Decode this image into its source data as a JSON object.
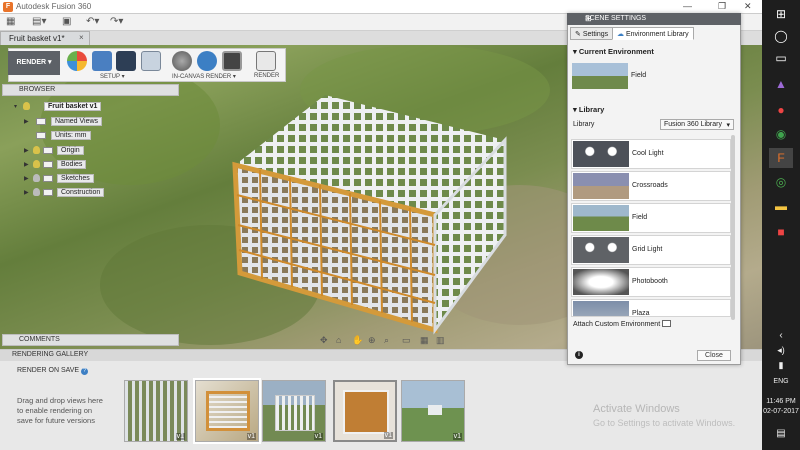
{
  "window": {
    "title": "Autodesk Fusion 360",
    "app_icon": "F"
  },
  "document_tab": {
    "label": "Fruit basket v1*",
    "close": "×"
  },
  "ribbon": {
    "workspace": "RENDER ▾",
    "setup_label": "SETUP ▾",
    "in_canvas_label": "IN-CANVAS RENDER ▾",
    "render_label": "RENDER"
  },
  "browser": {
    "header": "BROWSER",
    "items": [
      {
        "label": "Fruit basket v1"
      },
      {
        "label": "Named Views"
      },
      {
        "label": "Units: mm"
      },
      {
        "label": "Origin"
      },
      {
        "label": "Bodies"
      },
      {
        "label": "Sketches"
      },
      {
        "label": "Construction"
      }
    ]
  },
  "comments": {
    "header": "COMMENTS"
  },
  "rendering_gallery": {
    "header": "RENDERING GALLERY",
    "render_on_save": "RENDER ON SAVE",
    "drag_drop_text": "Drag and drop views here to enable rendering on save for future versions",
    "thumbnails": [
      {
        "version": "v1",
        "color": "#9aa07a"
      },
      {
        "version": "v1",
        "color": "#c9c2ad"
      },
      {
        "version": "v1",
        "color": "#8f9b73"
      },
      {
        "version": "v1",
        "color": "#b98a48"
      },
      {
        "version": "v1",
        "color": "#6f8f55"
      }
    ]
  },
  "watermark": {
    "line1": "Activate Windows",
    "line2": "Go to Settings to activate Windows."
  },
  "scene_settings": {
    "title": "SCENE SETTINGS",
    "tabs": [
      {
        "label": "Settings"
      },
      {
        "label": "Environment Library"
      }
    ],
    "current_env_header": "Current Environment",
    "current_env": "Field",
    "library_header": "Library",
    "library_label": "Library",
    "library_selected": "Fusion 360 Library",
    "environments": [
      {
        "name": "Cool Light",
        "color": "#555a63"
      },
      {
        "name": "Crossroads",
        "color": "#8a8fa8"
      },
      {
        "name": "Field",
        "color": "#7c9aa8"
      },
      {
        "name": "Grid Light",
        "color": "#6a6d70"
      },
      {
        "name": "Photobooth",
        "color": "#cfcfcf"
      },
      {
        "name": "Plaza",
        "color": "#7d8ea8"
      }
    ],
    "attach_label": "Attach Custom Environment",
    "close_label": "Close"
  },
  "taskbar": {
    "lang": "ENG",
    "time": "11:46 PM",
    "date": "02-07-2017"
  }
}
